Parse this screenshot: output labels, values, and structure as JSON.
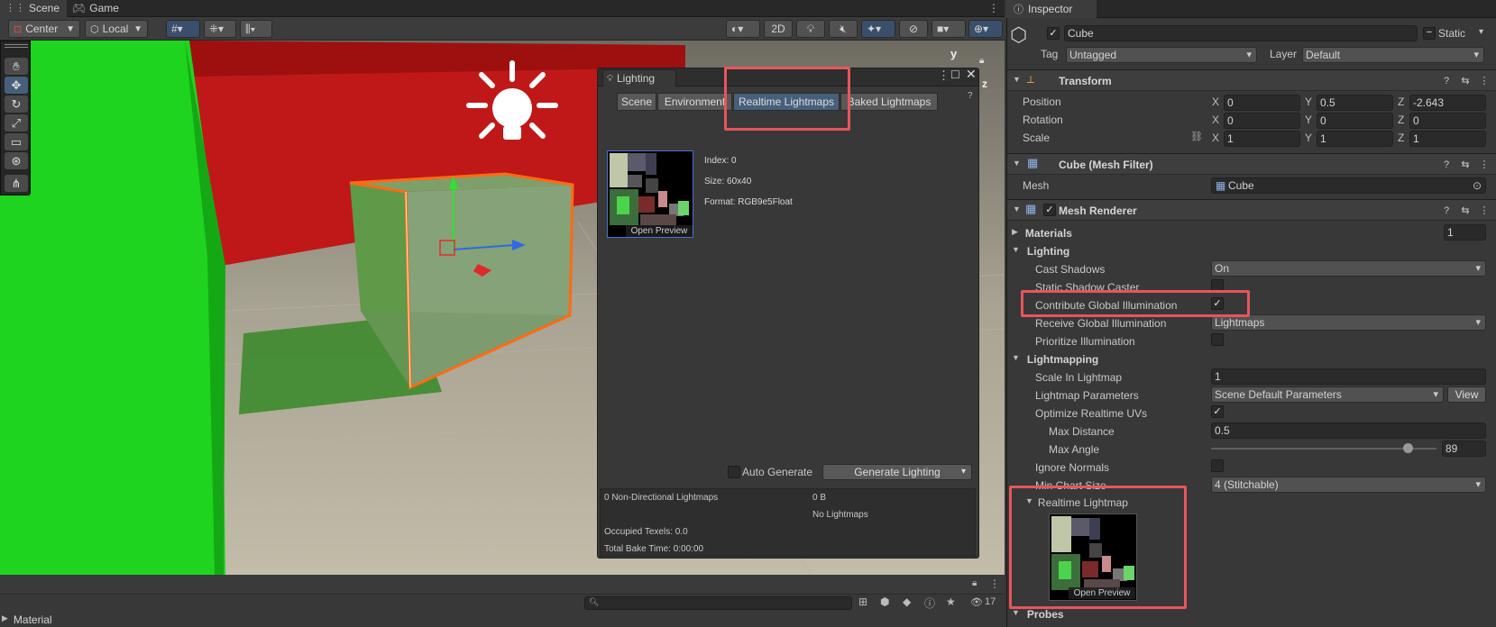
{
  "tabs": {
    "scene": "Scene",
    "game": "Game"
  },
  "scene_toolbar": {
    "pivot_mode": "Center",
    "pivot_rotation": "Local",
    "mode_2d": "2D"
  },
  "scene_gizmo": {
    "y_axis": "y",
    "z_axis": "z"
  },
  "lighting_window": {
    "title": "Lighting",
    "tabs": [
      "Scene",
      "Environment",
      "Realtime Lightmaps",
      "Baked Lightmaps"
    ],
    "active_tab": "Realtime Lightmaps",
    "lightmap_info": {
      "index": "Index: 0",
      "size": "Size: 60x40",
      "format": "Format: RGB9e5Float"
    },
    "open_preview": "Open Preview",
    "auto_generate_label": "Auto Generate",
    "generate_button": "Generate Lighting",
    "stats": {
      "directional": "0 Non-Directional Lightmaps",
      "size": "0 B",
      "no_lightmaps": "No Lightmaps",
      "occupied": "Occupied Texels: 0.0",
      "bake_time": "Total Bake Time: 0:00:00"
    }
  },
  "bottom_panel": {
    "item": "Material",
    "hidden_count": "17"
  },
  "inspector": {
    "title": "Inspector",
    "object_name": "Cube",
    "static_label": "Static",
    "tag_label": "Tag",
    "tag_value": "Untagged",
    "layer_label": "Layer",
    "layer_value": "Default",
    "transform": {
      "title": "Transform",
      "position_label": "Position",
      "rotation_label": "Rotation",
      "scale_label": "Scale",
      "position": {
        "x": "0",
        "y": "0.5",
        "z": "-2.643"
      },
      "rotation": {
        "x": "0",
        "y": "0",
        "z": "0"
      },
      "scale": {
        "x": "1",
        "y": "1",
        "z": "1"
      },
      "axis_x": "X",
      "axis_y": "Y",
      "axis_z": "Z"
    },
    "mesh_filter": {
      "title": "Cube (Mesh Filter)",
      "mesh_label": "Mesh",
      "mesh_value": "Cube"
    },
    "mesh_renderer": {
      "title": "Mesh Renderer",
      "materials_label": "Materials",
      "materials_count": "1",
      "lighting_label": "Lighting",
      "cast_shadows_label": "Cast Shadows",
      "cast_shadows_value": "On",
      "static_shadow_caster_label": "Static Shadow Caster",
      "contribute_gi_label": "Contribute Global Illumination",
      "receive_gi_label": "Receive Global Illumination",
      "receive_gi_value": "Lightmaps",
      "prioritize_label": "Prioritize Illumination",
      "lightmapping_label": "Lightmapping",
      "scale_lightmap_label": "Scale In Lightmap",
      "scale_lightmap_value": "1",
      "lightmap_params_label": "Lightmap Parameters",
      "lightmap_params_value": "Scene Default Parameters",
      "view_button": "View",
      "optimize_uvs_label": "Optimize Realtime UVs",
      "max_distance_label": "Max Distance",
      "max_distance_value": "0.5",
      "max_angle_label": "Max Angle",
      "max_angle_value": "89",
      "max_angle_level": 0.89,
      "ignore_normals_label": "Ignore Normals",
      "min_chart_label": "Min Chart Size",
      "min_chart_value": "4 (Stitchable)",
      "realtime_lightmap_label": "Realtime Lightmap",
      "open_preview": "Open Preview",
      "probes_label": "Probes"
    }
  },
  "colors": {
    "accent_red": "#e8555a",
    "selection_blue": "#46607c",
    "green_wall": "#1fcf1f",
    "red_wall": "#c41515"
  }
}
